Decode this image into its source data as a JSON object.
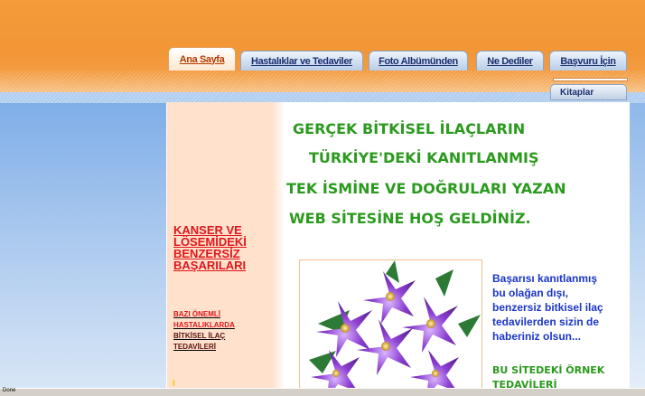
{
  "nav": {
    "tabs": [
      {
        "label": "Ana Sayfa",
        "active": true
      },
      {
        "label": "Hastalıklar ve Tedaviler",
        "active": false
      },
      {
        "label": "Foto Albümünden",
        "active": false
      },
      {
        "label": "Ne Dediler",
        "active": false
      },
      {
        "label": "Başvuru İçin",
        "active": false
      }
    ],
    "subtab": "Kitaplar"
  },
  "welcome": {
    "line1": "GERÇEK BİTKİSEL İLAÇLARIN",
    "line2": "TÜRKİYE'DEKİ KANITLANMIŞ",
    "line3": "TEK İSMİNE VE DOĞRULARI YAZAN",
    "line4": "WEB SİTESİNE HOŞ GELDİNİZ."
  },
  "sidebar": {
    "main_link": [
      "KANSER VE",
      "LÖSEMİDEKİ",
      "BENZERSİZ",
      "BAŞARILARI"
    ],
    "small_link": [
      "BAZI ÖNEMLİ",
      "HASTALIKLARDA",
      "BİTKİSEL İLAÇ",
      "TEDAVİLERİ"
    ],
    "bullet": "I"
  },
  "intro": {
    "text": [
      "Başarısı kanıtlanmış",
      "bu olağan dışı,",
      "benzersiz bitkisel ilaç",
      "tedavilerden sizin de",
      "haberiniz olsun..."
    ],
    "examples_heading": [
      "BU SİTEDEKİ ÖRNEK",
      "TEDAVİLERİ"
    ]
  },
  "image": {
    "name": "purple-flowers-image"
  },
  "status": {
    "text": "Done"
  },
  "colors": {
    "header_orange": "#f29636",
    "welcome_green": "#2b9a1e",
    "link_red": "#e0161a",
    "intro_blue": "#1b36c8",
    "sidebar_peach": "#ffe1cc"
  }
}
